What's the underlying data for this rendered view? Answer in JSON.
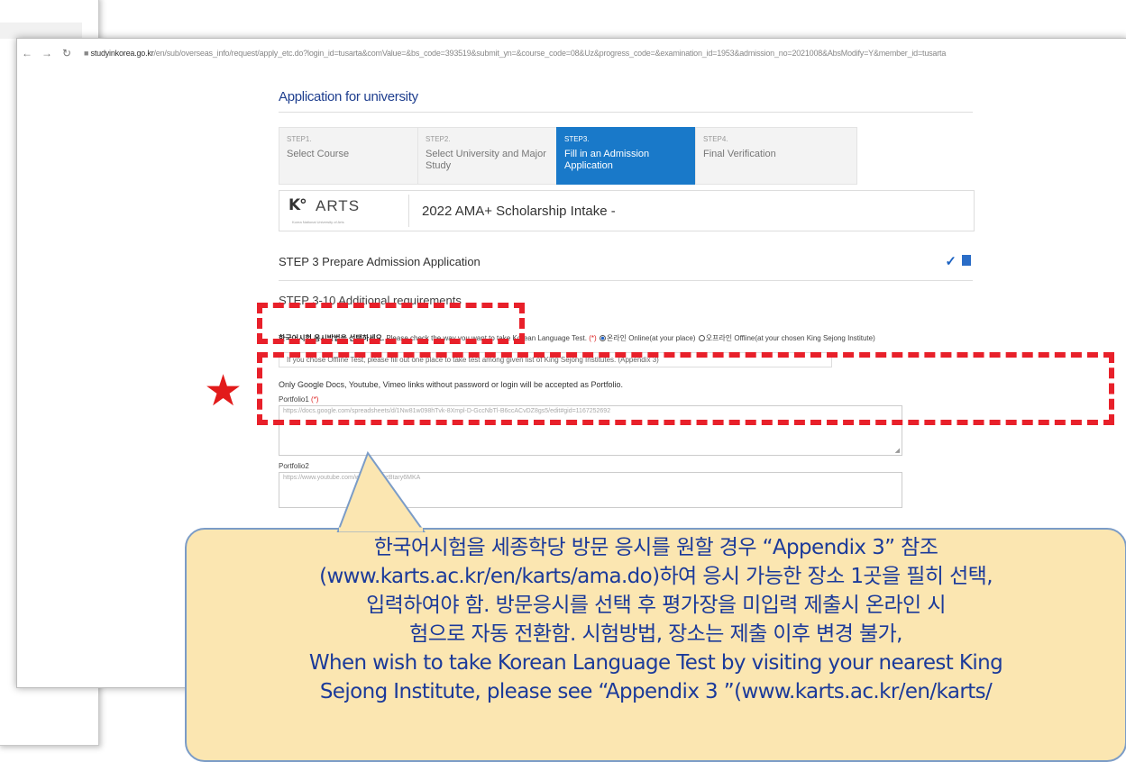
{
  "browser": {
    "url_host": "studyinkorea.go.kr",
    "url_rest": "/en/sub/overseas_info/request/apply_etc.do?login_id=tusarta&comValue=&bs_code=393519&submit_yn=&course_code=08&Uz&progress_code=&examination_id=1953&admission_no=2021008&AbsModify=Y&member_id=tusarta"
  },
  "page": {
    "title": "Application for university"
  },
  "steps": [
    {
      "num": "STEP1.",
      "label": "Select Course",
      "active": false
    },
    {
      "num": "STEP2.",
      "label": "Select University and Major Study",
      "active": false
    },
    {
      "num": "STEP3.",
      "label": "Fill in an Admission Application",
      "active": true
    },
    {
      "num": "STEP4.",
      "label": "Final Verification",
      "active": false
    }
  ],
  "university": {
    "logo_text": "K°ARTS",
    "logo_sub": "Korea National University of Arts",
    "intake": "2022 AMA+ Scholarship Intake -"
  },
  "section": {
    "title": "STEP 3 Prepare Admission Application",
    "subtitle": "STEP 3-10 Additional requirements"
  },
  "test_choice": {
    "prompt_bold": "한국어시험 응시방법을 선택하세요.",
    "prompt": "Please check the way you want to take Korean Language Test.",
    "req_mark": "(*)",
    "option_online": "온라인 Online(at your place)",
    "option_offline": "오프라인 Offline(at your chosen King Sejong Institute)"
  },
  "offline_field": {
    "placeholder": "If you chose Offline Test, please fill out one place to take test among given list of King Sejong Institutes. (Appendix 3)"
  },
  "portfolio": {
    "note": "Only Google Docs, Youtube, Vimeo links without password or login will be accepted as Portfolio.",
    "p1_label": "Portfolio1",
    "p1_req": "(*)",
    "p1_value": "https://docs.google.com/spreadsheets/d/1Nw81w098hTvk-8Xmpl-D-GccNbTl-B6ccACvDZ8gs5/edit#gid=1167252692",
    "p2_label": "Portfolio2",
    "p2_value": "https://www.youtube.com/watch?v=uzBtary6MKA"
  },
  "callout": {
    "lines": [
      "한국어시험을 세종학당 방문 응시를 원할 경우 “Appendix 3” 참조",
      "(www.karts.ac.kr/en/karts/ama.do)하여 응시 가능한 장소 1곳을 필히 선택,",
      "입력하여야 함. 방문응시를 선택 후 평가장을 미입력 제출시 온라인 시",
      "험으로 자동 전환함. 시험방법, 장소는 제출 이후 변경 불가,",
      "When wish to take Korean Language Test by visiting your nearest King",
      "Sejong Institute, please see “Appendix 3 ”(www.karts.ac.kr/en/karts/"
    ]
  },
  "icons": {
    "back": "arrow-left-icon",
    "forward": "arrow-right-icon",
    "reload": "reload-icon",
    "lock": "lock-icon",
    "check": "check-icon",
    "document": "document-icon",
    "star": "star-icon"
  },
  "colors": {
    "accent": "#1979c9",
    "highlight_dash": "#e8202a",
    "star": "#e21a1a",
    "callout_fill": "#fbe6b1",
    "callout_text": "#1b3a9a",
    "title_blue": "#1f3f8f"
  }
}
